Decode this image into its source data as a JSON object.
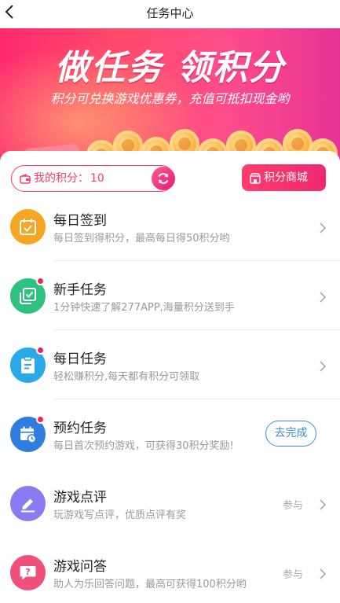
{
  "header": {
    "title": "任务中心"
  },
  "banner": {
    "headline": "做任务 领积分",
    "subline": "积分可兑换游戏优惠券，充值可抵扣现金哟"
  },
  "points": {
    "label": "我的积分：",
    "value": "10",
    "mall_label": "积分商城"
  },
  "tasks": [
    {
      "title": "每日签到",
      "desc": "每日签到得积分，最高每日得50积分哟",
      "icon": "calendar-check-icon",
      "color": "#f5a623",
      "badge": false
    },
    {
      "title": "新手任务",
      "desc": "1分钟快速了解277APP,海量积分送到手",
      "icon": "copy-check-icon",
      "color": "#2ec27e",
      "badge": true
    },
    {
      "title": "每日任务",
      "desc": "轻松赚积分,每天都有积分可领取",
      "icon": "clipboard-icon",
      "color": "#2aa9e8",
      "badge": true
    },
    {
      "title": "预约任务",
      "desc": "每日首次预约游戏，可获得30积分奖励!",
      "icon": "calendar-clock-icon",
      "color": "#2f7de1",
      "badge": true,
      "action": "去完成"
    },
    {
      "title": "游戏点评",
      "desc": "玩游戏写点评，优质点评有奖",
      "icon": "pen-icon",
      "color": "#8a7cf0",
      "badge": false,
      "action": "参与"
    },
    {
      "title": "游戏问答",
      "desc": "助人为乐回答问题，最高可获得100积分哟",
      "icon": "question-chat-icon",
      "color": "#f0517a",
      "badge": false,
      "action": "参与"
    }
  ],
  "colors": {
    "accent": "#ff3b6b",
    "blue": "#3a8de0"
  }
}
